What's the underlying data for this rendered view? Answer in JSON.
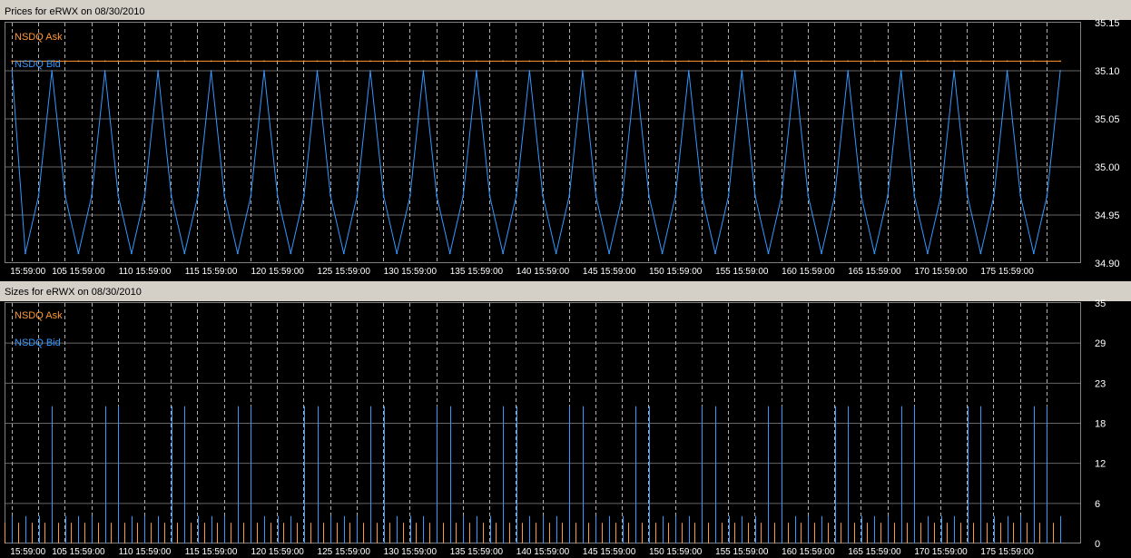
{
  "colors": {
    "ask": "#ff9933",
    "bid": "#3399ff",
    "background": "#000000",
    "header": "#d4d0c8",
    "grid": "#666666",
    "text": "#ffffff"
  },
  "x_tick_labels": [
    "15:59:00",
    "105 15:59:00",
    "110 15:59:00",
    "115 15:59:00",
    "120 15:59:00",
    "125 15:59:00",
    "130 15:59:00",
    "135 15:59:00",
    "140 15:59:00",
    "145 15:59:00",
    "150 15:59:00",
    "155 15:59:00",
    "160 15:59:00",
    "165 15:59:00",
    "170 15:59:00",
    "175 15:59:00"
  ],
  "chart_data": [
    {
      "type": "line",
      "title": "Prices for  eRWX  on  08/30/2010",
      "y_ticks": [
        "35.15",
        "35.10",
        "35.05",
        "35.00",
        "34.95",
        "34.90"
      ],
      "ylim": [
        34.9,
        35.15
      ],
      "grid": true,
      "legend": "top-left",
      "x": [
        101,
        102,
        103,
        104,
        105,
        106,
        107,
        108,
        109,
        110,
        111,
        112,
        113,
        114,
        115,
        116,
        117,
        118,
        119,
        120,
        121,
        122,
        123,
        124,
        125,
        126,
        127,
        128,
        129,
        130,
        131,
        132,
        133,
        134,
        135,
        136,
        137,
        138,
        139,
        140,
        141,
        142,
        143,
        144,
        145,
        146,
        147,
        148,
        149,
        150,
        151,
        152,
        153,
        154,
        155,
        156,
        157,
        158,
        159,
        160,
        161,
        162,
        163,
        164,
        165,
        166,
        167,
        168,
        169,
        170,
        171,
        172,
        173,
        174,
        175,
        176,
        177,
        178,
        179,
        180
      ],
      "series": [
        {
          "name": "NSDQ Ask",
          "values": [
            35.11,
            35.11,
            35.11,
            35.11,
            35.11,
            35.11,
            35.11,
            35.11,
            35.11,
            35.11,
            35.11,
            35.11,
            35.11,
            35.11,
            35.11,
            35.11,
            35.11,
            35.11,
            35.11,
            35.11,
            35.11,
            35.11,
            35.11,
            35.11,
            35.11,
            35.11,
            35.11,
            35.11,
            35.11,
            35.11,
            35.11,
            35.11,
            35.11,
            35.11,
            35.11,
            35.11,
            35.11,
            35.11,
            35.11,
            35.11,
            35.11,
            35.11,
            35.11,
            35.11,
            35.11,
            35.11,
            35.11,
            35.11,
            35.11,
            35.11,
            35.11,
            35.11,
            35.11,
            35.11,
            35.11,
            35.11,
            35.11,
            35.11,
            35.11,
            35.11,
            35.11,
            35.11,
            35.11,
            35.11,
            35.11,
            35.11,
            35.11,
            35.11,
            35.11,
            35.11,
            35.11,
            35.11,
            35.11,
            35.11,
            35.11,
            35.11,
            35.11,
            35.11,
            35.11,
            35.11
          ]
        },
        {
          "name": "NSDQ Bid",
          "values": [
            35.1,
            34.91,
            34.97,
            35.1,
            34.97,
            34.91,
            34.97,
            35.1,
            34.97,
            34.91,
            34.97,
            35.1,
            34.97,
            34.91,
            34.97,
            35.1,
            34.97,
            34.91,
            34.97,
            35.1,
            34.97,
            34.91,
            34.97,
            35.1,
            34.97,
            34.91,
            34.97,
            35.1,
            34.97,
            34.91,
            34.97,
            35.1,
            34.97,
            34.91,
            34.97,
            35.1,
            34.97,
            34.91,
            34.97,
            35.1,
            34.97,
            34.91,
            34.97,
            35.1,
            34.97,
            34.91,
            34.97,
            35.1,
            34.97,
            34.91,
            34.97,
            35.1,
            34.97,
            34.91,
            34.97,
            35.1,
            34.97,
            34.91,
            34.97,
            35.1,
            34.97,
            34.91,
            34.97,
            35.1,
            34.97,
            34.91,
            34.97,
            35.1,
            34.97,
            34.91,
            34.97,
            35.1,
            34.97,
            34.91,
            34.97,
            35.1,
            34.97,
            34.91,
            34.97,
            35.1
          ]
        }
      ]
    },
    {
      "type": "bar",
      "title": "Sizes for  eRWX  on  08/30/2010",
      "y_ticks": [
        "35",
        "29",
        "23",
        "18",
        "12",
        "6",
        "0"
      ],
      "ylim": [
        0,
        35
      ],
      "grid": true,
      "legend": "top-left",
      "x": [
        101,
        102,
        103,
        104,
        105,
        106,
        107,
        108,
        109,
        110,
        111,
        112,
        113,
        114,
        115,
        116,
        117,
        118,
        119,
        120,
        121,
        122,
        123,
        124,
        125,
        126,
        127,
        128,
        129,
        130,
        131,
        132,
        133,
        134,
        135,
        136,
        137,
        138,
        139,
        140,
        141,
        142,
        143,
        144,
        145,
        146,
        147,
        148,
        149,
        150,
        151,
        152,
        153,
        154,
        155,
        156,
        157,
        158,
        159,
        160,
        161,
        162,
        163,
        164,
        165,
        166,
        167,
        168,
        169,
        170,
        171,
        172,
        173,
        174,
        175,
        176,
        177,
        178,
        179,
        180
      ],
      "series": [
        {
          "name": "NSDQ Ask",
          "values": [
            3,
            3,
            3,
            3,
            3,
            3,
            3,
            3,
            3,
            3,
            3,
            3,
            3,
            3,
            3,
            3,
            3,
            3,
            3,
            3,
            3,
            3,
            3,
            3,
            3,
            3,
            3,
            3,
            3,
            3,
            3,
            3,
            3,
            3,
            3,
            3,
            3,
            3,
            3,
            3,
            3,
            3,
            3,
            3,
            3,
            3,
            3,
            3,
            3,
            3,
            3,
            3,
            3,
            3,
            3,
            3,
            3,
            3,
            3,
            3,
            3,
            3,
            3,
            3,
            3,
            3,
            3,
            3,
            3,
            3,
            3,
            3,
            3,
            3,
            3,
            3,
            3,
            3,
            3,
            3
          ]
        },
        {
          "name": "NSDQ Bid",
          "values": [
            4,
            4,
            4,
            20,
            4,
            4,
            4,
            20,
            20,
            4,
            4,
            4,
            20,
            20,
            4,
            4,
            4,
            20,
            20,
            4,
            4,
            4,
            20,
            20,
            4,
            4,
            4,
            20,
            20,
            4,
            4,
            4,
            20,
            20,
            4,
            4,
            4,
            20,
            20,
            4,
            4,
            4,
            20,
            20,
            4,
            4,
            4,
            20,
            20,
            4,
            4,
            4,
            20,
            20,
            4,
            4,
            4,
            20,
            20,
            4,
            4,
            4,
            20,
            20,
            4,
            4,
            4,
            20,
            20,
            4,
            4,
            4,
            20,
            20,
            4,
            4,
            4,
            20,
            20,
            4
          ]
        }
      ]
    }
  ]
}
